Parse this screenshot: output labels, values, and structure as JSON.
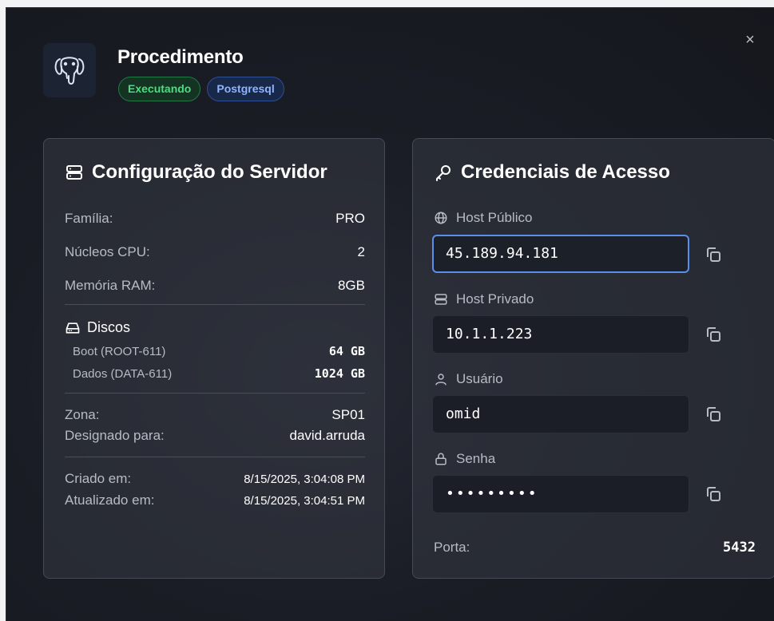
{
  "header": {
    "title": "Procedimento",
    "status_badge": "Executando",
    "engine_badge": "Postgresql",
    "close_glyph": "×"
  },
  "server_config": {
    "title": "Configuração do Servidor",
    "rows": [
      {
        "label": "Família:",
        "value": "PRO"
      },
      {
        "label": "Núcleos CPU:",
        "value": "2"
      },
      {
        "label": "Memória RAM:",
        "value": "8GB"
      }
    ],
    "disks_title": "Discos",
    "disks": [
      {
        "label": "Boot (ROOT-611)",
        "value": "64 GB"
      },
      {
        "label": "Dados (DATA-611)",
        "value": "1024 GB"
      }
    ],
    "zone_label": "Zona:",
    "zone_value": "SP01",
    "assigned_label": "Designado para:",
    "assigned_value": "david.arruda",
    "created_label": "Criado em:",
    "created_value": "8/15/2025, 3:04:08 PM",
    "updated_label": "Atualizado em:",
    "updated_value": "8/15/2025, 3:04:51 PM"
  },
  "credentials": {
    "title": "Credenciais de Acesso",
    "fields": [
      {
        "label": "Host Público",
        "value": "45.189.94.181",
        "icon": "globe-icon"
      },
      {
        "label": "Host Privado",
        "value": "10.1.1.223",
        "icon": "server-icon"
      },
      {
        "label": "Usuário",
        "value": "omid",
        "icon": "user-icon"
      },
      {
        "label": "Senha",
        "value": "•••••••••",
        "icon": "lock-icon"
      }
    ],
    "port_label": "Porta:",
    "port_value": "5432"
  },
  "colors": {
    "accent_focus": "#5b8eea",
    "status_green": "#4ade80",
    "engine_blue": "#8fb3ff"
  }
}
